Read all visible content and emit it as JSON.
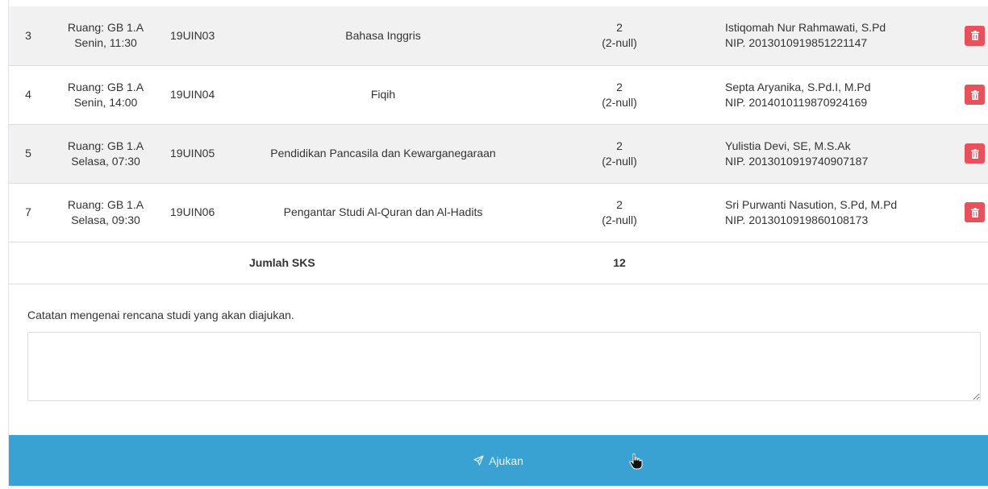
{
  "courses": [
    {
      "no": "3",
      "ruang": "Ruang: GB 1.A",
      "jadwal": "Senin, 11:30",
      "kode": "19UIN03",
      "mata_kuliah": "Bahasa Inggris",
      "sks": "2",
      "sks_detail": "(2-null)",
      "dosen": "Istiqomah Nur Rahmawati, S.Pd",
      "nip": "NIP. 2013010919851221147"
    },
    {
      "no": "4",
      "ruang": "Ruang: GB 1.A",
      "jadwal": "Senin, 14:00",
      "kode": "19UIN04",
      "mata_kuliah": "Fiqih",
      "sks": "2",
      "sks_detail": "(2-null)",
      "dosen": "Septa Aryanika, S.Pd.I, M.Pd",
      "nip": "NIP. 2014010119870924169"
    },
    {
      "no": "5",
      "ruang": "Ruang: GB 1.A",
      "jadwal": "Selasa, 07:30",
      "kode": "19UIN05",
      "mata_kuliah": "Pendidikan Pancasila dan Kewarganegaraan",
      "sks": "2",
      "sks_detail": "(2-null)",
      "dosen": "Yulistia Devi, SE, M.S.Ak",
      "nip": "NIP. 2013010919740907187"
    },
    {
      "no": "7",
      "ruang": "Ruang: GB 1.A",
      "jadwal": "Selasa, 09:30",
      "kode": "19UIN06",
      "mata_kuliah": "Pengantar Studi Al-Quran dan Al-Hadits",
      "sks": "2",
      "sks_detail": "(2-null)",
      "dosen": "Sri Purwanti Nasution, S.Pd, M.Pd",
      "nip": "NIP. 2013010919860108173"
    }
  ],
  "total": {
    "label": "Jumlah SKS",
    "value": "12"
  },
  "note": {
    "label": "Catatan mengenai rencana studi yang akan diajukan.",
    "value": "",
    "placeholder": ""
  },
  "submit": {
    "label": "Ajukan",
    "icon": "paper-plane-icon"
  },
  "delete_icon": "trash-icon",
  "colors": {
    "delete": "#e8505b",
    "submit": "#3aa1d3",
    "row_stripe": "#f1f1f1"
  }
}
